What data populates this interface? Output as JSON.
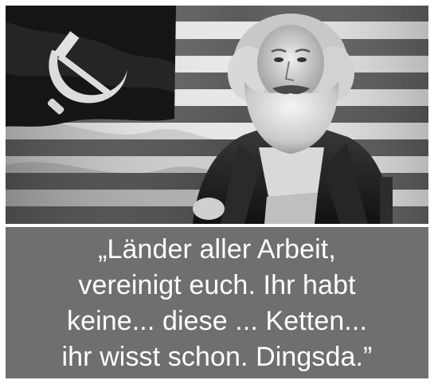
{
  "meme": {
    "background_color": "#ffffff",
    "caption_background": "#6f6f6f",
    "caption_text_color": "#ffffff",
    "caption_lines": [
      "„Länder aller Arbeit,",
      "vereinigt euch. Ihr habt",
      "keine... diese ... Ketten...",
      "ihr wisst schon. Dingsda.”"
    ],
    "photo": {
      "style": "black-and-white",
      "flag": "american-flag-with-hammer-and-sickle",
      "emblem_icon": "hammer-and-sickle-icon"
    }
  }
}
